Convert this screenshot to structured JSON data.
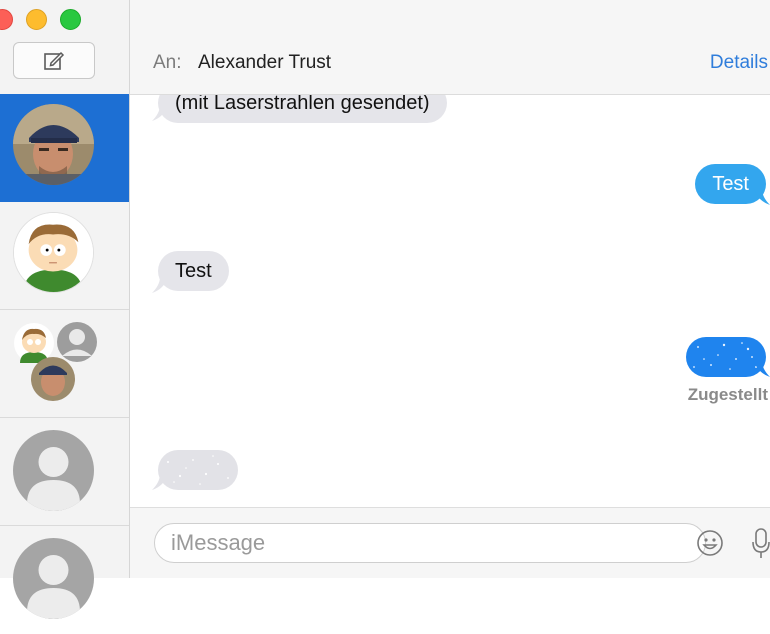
{
  "window": {
    "buttons": [
      "close",
      "minimize",
      "maximize"
    ]
  },
  "sidebar": {
    "compose_icon": "compose-icon",
    "conversations": [
      {
        "avatar": "photo-man-cap",
        "selected": true
      },
      {
        "avatar": "cartoon-boy",
        "selected": false
      },
      {
        "avatar": "group-avatar",
        "selected": false
      },
      {
        "avatar": "placeholder-person",
        "selected": false
      },
      {
        "avatar": "placeholder-person",
        "selected": false
      }
    ]
  },
  "header": {
    "to_label": "An:",
    "recipient": "Alexander Trust",
    "details": "Details"
  },
  "transcript": {
    "messages": [
      {
        "direction": "in",
        "text": "(mit Laserstrahlen gesendet)"
      },
      {
        "direction": "out",
        "text": "Test"
      },
      {
        "direction": "in",
        "text": "Test"
      },
      {
        "direction": "out",
        "text": "",
        "effect": "invisible-ink"
      },
      {
        "direction": "in",
        "text": "",
        "effect": "invisible-ink"
      }
    ],
    "delivered_label": "Zugestellt"
  },
  "composer": {
    "placeholder": "iMessage",
    "emoji_icon": "emoji-icon",
    "mic_icon": "microphone-icon"
  },
  "colors": {
    "selection": "#1d6fd3",
    "outgoing": "#33a6ee",
    "incoming": "#e5e5ea",
    "link": "#2f7ddb"
  }
}
